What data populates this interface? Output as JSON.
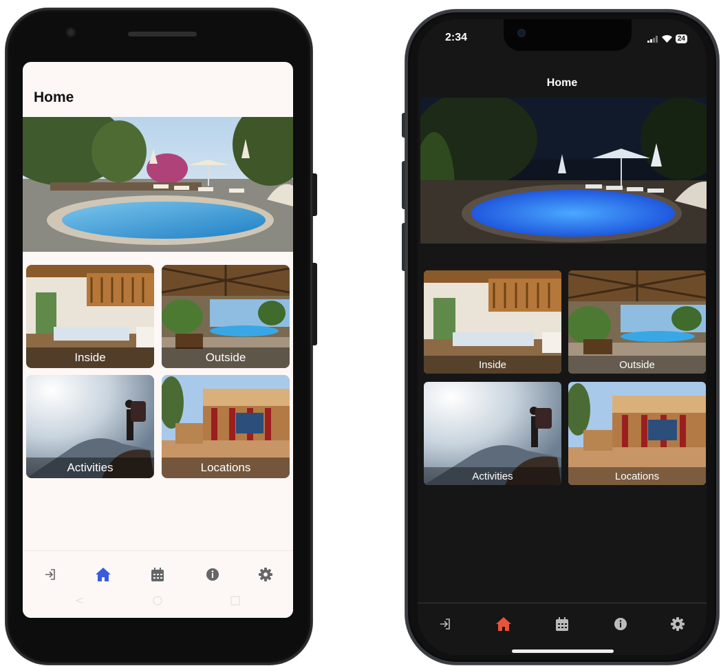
{
  "android_app": {
    "title": "Home",
    "categories": [
      {
        "label": "Inside"
      },
      {
        "label": "Outside"
      },
      {
        "label": "Activities"
      },
      {
        "label": "Locations"
      }
    ],
    "nav": [
      {
        "icon": "login-icon",
        "active": false
      },
      {
        "icon": "home-icon",
        "active": true
      },
      {
        "icon": "calendar-icon",
        "active": false
      },
      {
        "icon": "info-icon",
        "active": false
      },
      {
        "icon": "settings-gear-icon",
        "active": false
      }
    ],
    "colors": {
      "background": "#fdf7f6",
      "active_nav": "#3b5bdb",
      "inactive_nav": "#666666"
    }
  },
  "ios_app": {
    "status_time": "2:34",
    "battery": "24",
    "title": "Home",
    "categories": [
      {
        "label": "Inside"
      },
      {
        "label": "Outside"
      },
      {
        "label": "Activities"
      },
      {
        "label": "Locations"
      }
    ],
    "nav": [
      {
        "icon": "login-icon",
        "active": false
      },
      {
        "icon": "home-icon",
        "active": true
      },
      {
        "icon": "calendar-icon",
        "active": false
      },
      {
        "icon": "info-icon",
        "active": false
      },
      {
        "icon": "settings-gear-icon",
        "active": false
      }
    ],
    "colors": {
      "background": "#161616",
      "active_nav": "#e8533a",
      "inactive_nav": "#bbbbbb"
    }
  }
}
